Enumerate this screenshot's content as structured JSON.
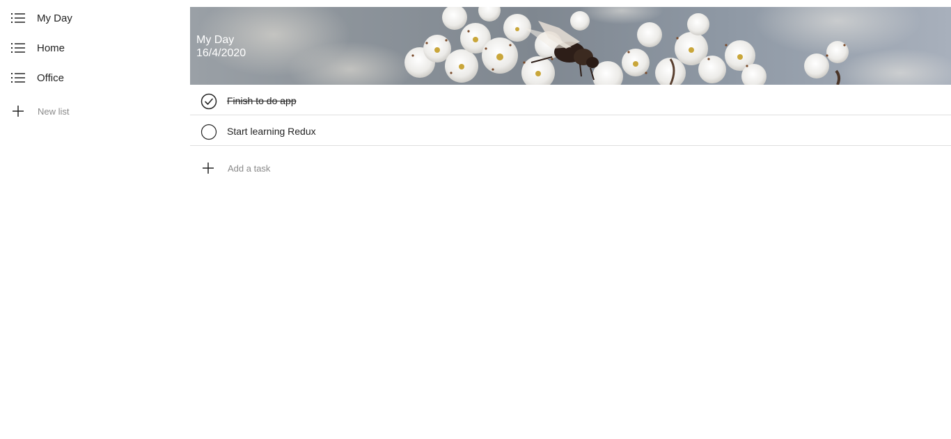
{
  "sidebar": {
    "lists": [
      {
        "label": "My Day",
        "icon": "list-icon"
      },
      {
        "label": "Home",
        "icon": "list-icon"
      },
      {
        "label": "Office",
        "icon": "list-icon"
      }
    ],
    "new_list_label": "New list",
    "new_list_icon": "plus-icon"
  },
  "banner": {
    "title": "My Day",
    "date": "16/4/2020"
  },
  "tasks": [
    {
      "text": "Finish to do app",
      "completed": true,
      "icon": "check-circle-icon"
    },
    {
      "text": "Start learning Redux",
      "completed": false,
      "icon": "empty-circle-icon"
    }
  ],
  "add_task": {
    "placeholder": "Add a task",
    "icon": "plus-icon"
  },
  "colors": {
    "text": "#222222",
    "muted": "#8a8a8a",
    "divider": "#dedede",
    "banner_text": "#ffffff"
  }
}
